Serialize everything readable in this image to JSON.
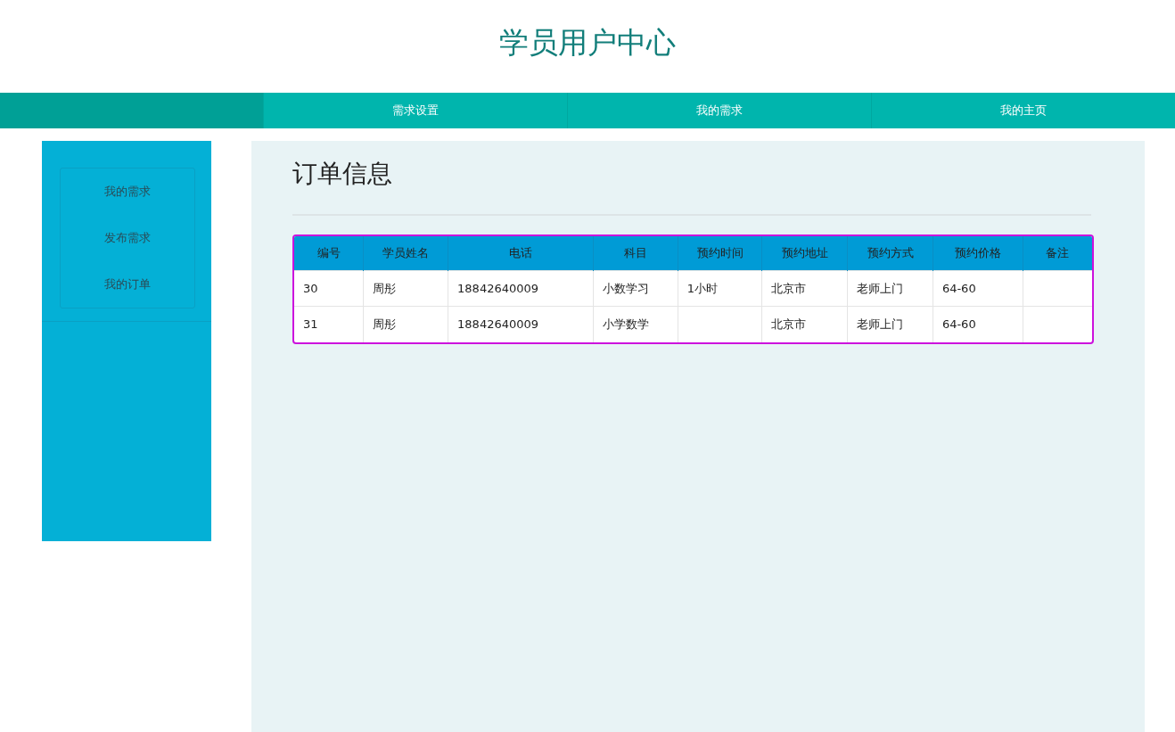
{
  "header": {
    "title": "学员用户中心"
  },
  "nav": {
    "items": [
      {
        "label": "需求设置"
      },
      {
        "label": "我的需求"
      },
      {
        "label": "我的主页"
      }
    ]
  },
  "sidebar": {
    "items": [
      {
        "label": "我的需求"
      },
      {
        "label": "发布需求"
      },
      {
        "label": "我的订单"
      }
    ]
  },
  "main": {
    "heading": "订单信息",
    "table": {
      "columns": [
        "编号",
        "学员姓名",
        "电话",
        "科目",
        "预约时间",
        "预约地址",
        "预约方式",
        "预约价格",
        "备注"
      ],
      "rows": [
        {
          "cells": [
            "30",
            "周彤",
            "18842640009",
            "小数学习",
            "1小时",
            "北京市",
            "老师上门",
            "64-60",
            null
          ]
        },
        {
          "cells": [
            "31",
            "周彤",
            "18842640009",
            "小学数学",
            null,
            "北京市",
            "老师上门",
            "64-60",
            null
          ]
        }
      ]
    }
  }
}
